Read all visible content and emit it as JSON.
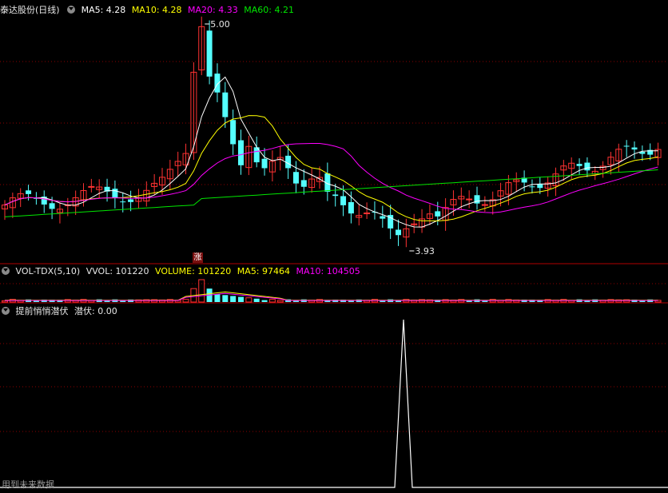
{
  "main": {
    "stock_title": "泰达股份(日线)",
    "ma5": "MA5: 4.28",
    "ma10": "MA10: 4.28",
    "ma20": "MA20: 4.33",
    "ma60": "MA60: 4.21",
    "high_label": "5.00",
    "low_label": "3.93",
    "limit_up_badge": "涨"
  },
  "volume": {
    "indicator": "VOL-TDX(5,10)",
    "vvol": "VVOL: 101220",
    "volume": "VOLUME: 101220",
    "ma5": "MA5: 97464",
    "ma10": "MA10: 104505"
  },
  "indicator": {
    "name": "提前悄悄潜伏",
    "value": "潜伏: 0.00"
  },
  "footer": {
    "note": "用到未来数据"
  },
  "colors": {
    "up": "#ff3232",
    "down": "#54ffff",
    "ma5": "#ffffff",
    "ma10": "#ffff00",
    "ma20": "#ff00ff",
    "ma60": "#00e600",
    "grid": "#8b0000"
  },
  "icons": [
    "dropdown-circle-icon"
  ],
  "chart_data": {
    "type": "line",
    "title": "提前悄悄潜伏",
    "series": [
      {
        "name": "潜伏",
        "x_index": [
          0,
          63,
          64,
          65,
          90
        ],
        "values": [
          0,
          0,
          1,
          0,
          0
        ]
      }
    ]
  }
}
